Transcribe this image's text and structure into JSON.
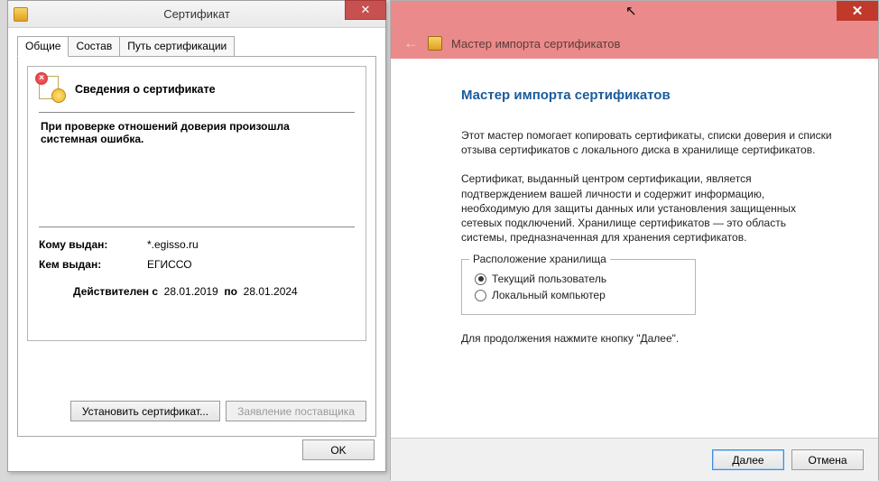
{
  "cert": {
    "window_title": "Сертификат",
    "tabs": {
      "general": "Общие",
      "details": "Состав",
      "path": "Путь сертификации"
    },
    "info_caption": "Сведения о сертификате",
    "error_line1": "При проверке отношений доверия произошла",
    "error_line2": "системная ошибка.",
    "issued_to_label": "Кому выдан:",
    "issued_to_value": "*.egisso.ru",
    "issued_by_label": "Кем выдан:",
    "issued_by_value": "ЕГИССО",
    "valid_from_label": "Действителен с",
    "valid_from_value": "28.01.2019",
    "valid_to_word": "по",
    "valid_to_value": "28.01.2024",
    "install_btn": "Установить сертификат...",
    "vendor_btn": "Заявление поставщика",
    "ok_btn": "OK"
  },
  "wiz": {
    "breadcrumb": "Мастер импорта сертификатов",
    "heading": "Мастер импорта сертификатов",
    "para1": "Этот мастер помогает копировать сертификаты, списки доверия и списки отзыва сертификатов с локального диска в хранилище сертификатов.",
    "para2": "Сертификат, выданный центром сертификации, является подтверждением вашей личности и содержит информацию, необходимую для защиты данных или установления защищенных сетевых подключений. Хранилище сертификатов — это область системы, предназначенная для хранения сертификатов.",
    "group_legend": "Расположение хранилища",
    "radio_current": "Текущий пользователь",
    "radio_local": "Локальный компьютер",
    "continue_hint": "Для продолжения нажмите кнопку \"Далее\".",
    "next_btn": "Далее",
    "cancel_btn": "Отмена"
  }
}
